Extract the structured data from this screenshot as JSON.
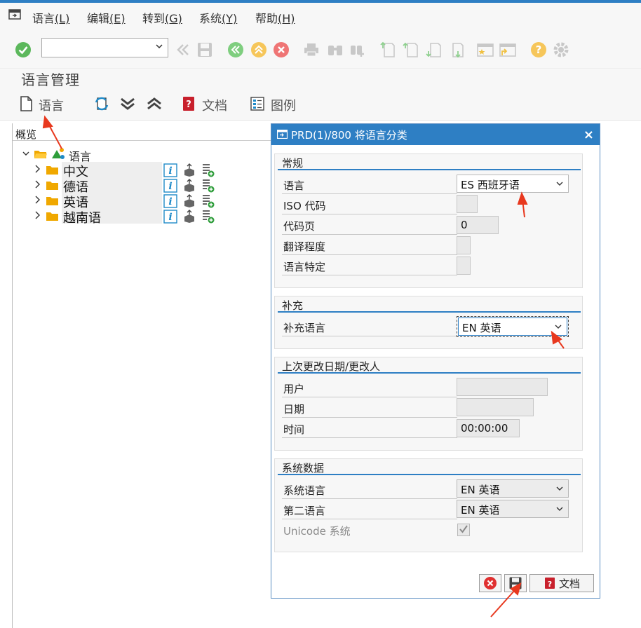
{
  "menu": {
    "items": [
      {
        "label": "语言",
        "key": "(L)"
      },
      {
        "label": "编辑",
        "key": "(E)"
      },
      {
        "label": "转到",
        "key": "(G)"
      },
      {
        "label": "系统",
        "key": "(Y)"
      },
      {
        "label": "帮助",
        "key": "(H)"
      }
    ]
  },
  "toolbar": {
    "command_value": ""
  },
  "page": {
    "title": "语言管理"
  },
  "app_toolbar": {
    "language_label": "语言",
    "document_label": "文档",
    "legend_label": "图例"
  },
  "tree": {
    "header": "概览",
    "root_label": "语言",
    "items": [
      "中文",
      "德语",
      "英语",
      "越南语"
    ]
  },
  "dialog": {
    "title": "PRD(1)/800 将语言分类",
    "close_glyph": "×",
    "general": {
      "title": "常规",
      "language_label": "语言",
      "language_value": "ES 西班牙语",
      "iso_label": "ISO 代码",
      "iso_value": "",
      "codepage_label": "代码页",
      "codepage_value": "0",
      "translation_label": "翻译程度",
      "specific_label": "语言特定"
    },
    "supplement": {
      "title": "补充",
      "label": "补充语言",
      "value": "EN 英语"
    },
    "last_change": {
      "title": "上次更改日期/更改人",
      "user_label": "用户",
      "date_label": "日期",
      "time_label": "时间",
      "time_value": "00:00:00"
    },
    "system_data": {
      "title": "系统数据",
      "system_lang_label": "系统语言",
      "system_lang_value": "EN 英语",
      "second_lang_label": "第二语言",
      "second_lang_value": "EN 英语",
      "unicode_label": "Unicode 系统",
      "unicode_checked": true
    },
    "footer": {
      "doc_label": "文档"
    }
  },
  "colors": {
    "accent": "#2e7fc4",
    "annotation_arrow": "#e8381e",
    "ok_green": "#5cb85c",
    "cancel_red": "#e04848",
    "help_yellow": "#f0b428",
    "folder_orange": "#f0a800"
  }
}
